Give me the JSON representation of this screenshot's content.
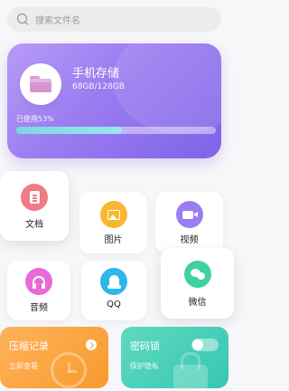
{
  "search": {
    "placeholder": "搜索文件名"
  },
  "storage": {
    "title": "手机存储",
    "capacity": "68GB/128GB",
    "used_label": "已使用53%",
    "used_fraction": 0.53,
    "gradient_colors": [
      "#b79bf6",
      "#7f63e8"
    ]
  },
  "categories": [
    {
      "label": "文档",
      "icon": "document-icon",
      "color": "#f07a86"
    },
    {
      "label": "图片",
      "icon": "image-icon",
      "color": "#f7b72f"
    },
    {
      "label": "视频",
      "icon": "video-icon",
      "color": "#9b7cf2"
    },
    {
      "label": "音频",
      "icon": "headphones-icon",
      "color": "#e86ad7"
    },
    {
      "label": "QQ",
      "icon": "qq-icon",
      "color": "#2fb6ec"
    },
    {
      "label": "微信",
      "icon": "wechat-icon",
      "color": "#3fd1a1"
    }
  ],
  "cards": {
    "zip": {
      "title": "压缩记录",
      "subtitle": "立即查看",
      "color": "#f89a2e"
    },
    "password": {
      "title": "密码锁",
      "subtitle": "保护隐私",
      "toggle_on": false,
      "color": "#37c7b1"
    }
  }
}
